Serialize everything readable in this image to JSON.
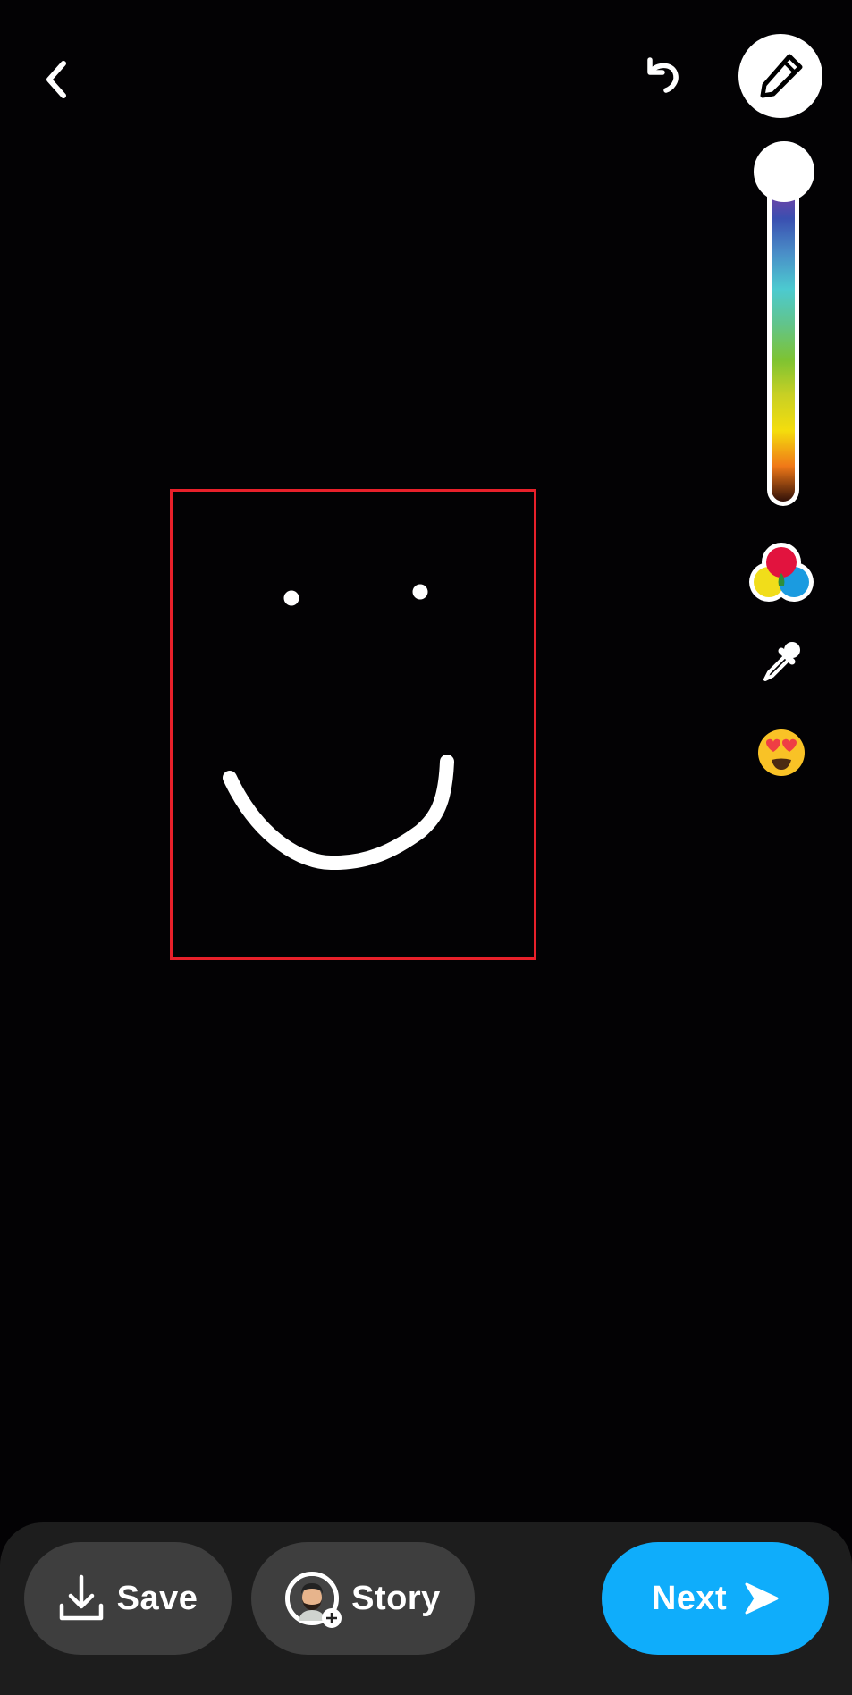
{
  "toolbar": {
    "back_icon": "chevron-left-icon",
    "undo_icon": "undo-icon",
    "pen_icon": "pencil-icon",
    "pen_active": true
  },
  "color_picker": {
    "gradient_colors": [
      "#c9327e",
      "#8a3ca3",
      "#3a4fb0",
      "#4a8fc8",
      "#4ccad0",
      "#62c48a",
      "#7ec332",
      "#c9d024",
      "#f4dd0d",
      "#f07818",
      "#311008"
    ],
    "selected_color": "#ffffff",
    "thumb_position_fraction": 0.0
  },
  "side_tools": [
    {
      "name": "palette",
      "icon": "color-palette-icon"
    },
    {
      "name": "eyedropper",
      "icon": "eyedropper-icon"
    },
    {
      "name": "emoji",
      "icon": "heart-eyes-emoji-icon",
      "glyph": "😍"
    }
  ],
  "canvas": {
    "drawing": "smiley-face",
    "stroke_color": "#ffffff",
    "highlight_color": "#e8202a"
  },
  "bottom_bar": {
    "save_label": "Save",
    "story_label": "Story",
    "next_label": "Next",
    "next_color": "#0fadfb"
  }
}
